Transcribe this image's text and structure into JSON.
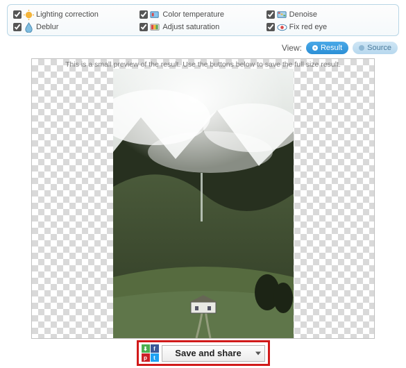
{
  "options": [
    {
      "key": "lighting",
      "label": "Lighting correction",
      "checked": true,
      "icon": "sun-icon"
    },
    {
      "key": "colortemp",
      "label": "Color temperature",
      "checked": true,
      "icon": "thermo-icon"
    },
    {
      "key": "denoise",
      "label": "Denoise",
      "checked": true,
      "icon": "noise-icon"
    },
    {
      "key": "deblur",
      "label": "Deblur",
      "checked": true,
      "icon": "drop-icon"
    },
    {
      "key": "saturation",
      "label": "Adjust saturation",
      "checked": true,
      "icon": "sat-icon"
    },
    {
      "key": "redeye",
      "label": "Fix red eye",
      "checked": true,
      "icon": "eye-icon"
    }
  ],
  "view": {
    "label": "View:",
    "tabs": {
      "result": "Result",
      "source": "Source",
      "active": "result"
    }
  },
  "preview": {
    "caption": "This is a small preview of the result. Use the buttons below to save the full size result."
  },
  "save": {
    "button": "Save and share"
  },
  "icons": {
    "sun-icon": "#f4b43a",
    "thermo-icon": "#3a9bd8",
    "noise-icon": "#3a9bd8",
    "drop-icon": "#6fb0d8",
    "sat-icon": "#e06a2a",
    "eye-icon": "#d84a4a"
  }
}
